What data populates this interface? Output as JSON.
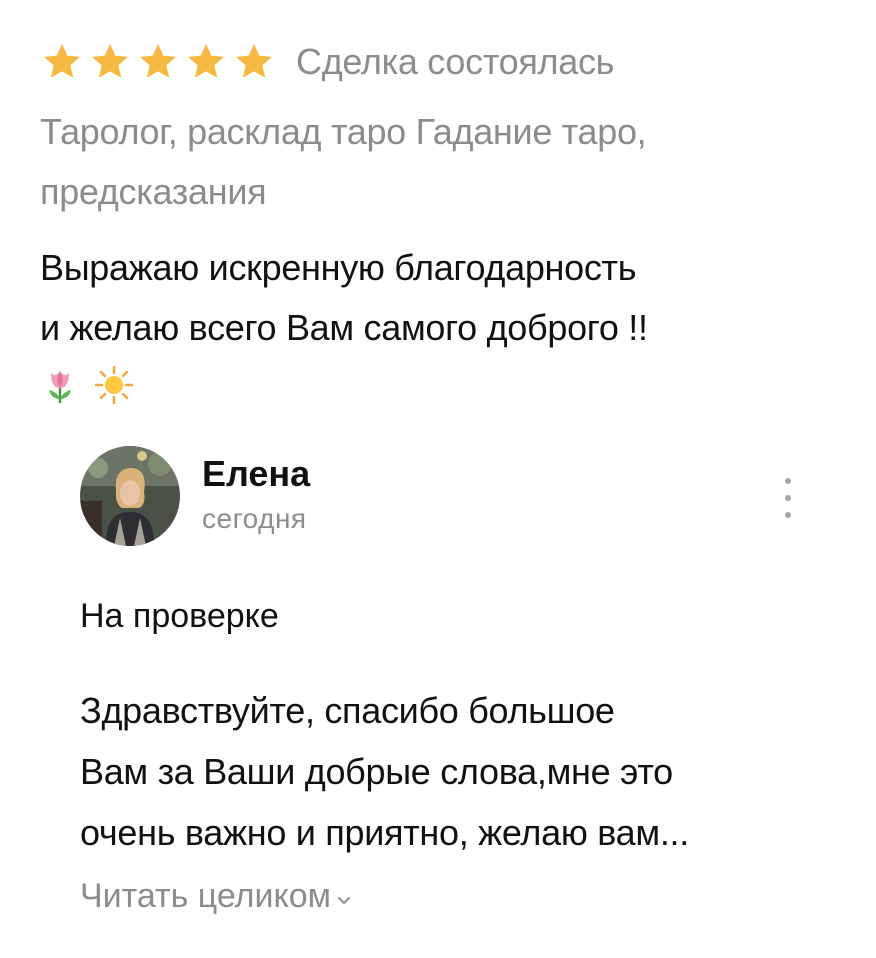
{
  "review": {
    "rating": 5,
    "rating_max": 5,
    "star_color": "#F5B942",
    "deal_status": "Сделка состоялась",
    "service": "Таролог, расклад таро Гадание таро, предсказания",
    "text_line1": "Выражаю искренную благодарность",
    "text_line2": "и желаю всего Вам самого доброго !!",
    "emojis": [
      "tulip-icon",
      "sun-icon"
    ]
  },
  "reply": {
    "author": "Елена",
    "date": "сегодня",
    "status": "На проверке",
    "text_line1": "Здравствуйте, спасибо большое",
    "text_line2": "Вам за Ваши добрые слова,мне это",
    "text_line3": "очень важно и приятно, желаю вам...",
    "read_more": "Читать целиком",
    "menu_icon": "more-vertical-icon"
  }
}
